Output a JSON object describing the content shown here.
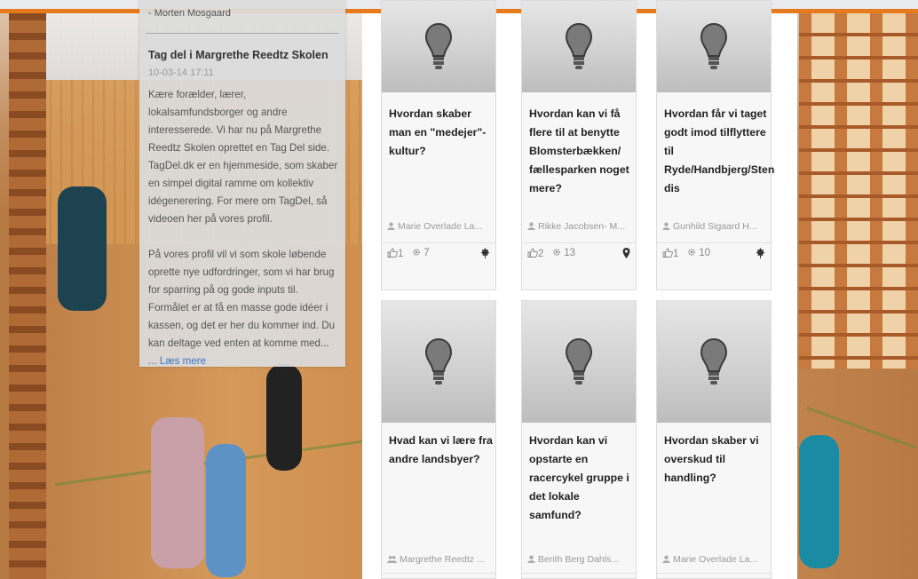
{
  "colors": {
    "accent": "#e67b1e",
    "link": "#3a79c7"
  },
  "info": {
    "author": "- Morten Mosgaard",
    "title": "Tag del i Margrethe Reedtz Skolen",
    "date": "10-03-14 17:11",
    "paragraph1": "Kære forælder, lærer, lokalsamfundsborger og andre interesserede. Vi har nu på Margrethe Reedtz Skolen oprettet en Tag Del side. TagDel.dk er en hjemmeside, som skaber en simpel digital ramme om kollektiv idégenerering. For mere om TagDel, så videoen her på vores profil.",
    "paragraph2": "På vores profil vil vi som skole løbende oprette nye udfordringer, som vi har brug for sparring på og gode inputs til. Formålet er at få en masse gode idéer i kassen, og det er her du kommer ind. Du kan deltage ved enten at komme med...",
    "more": "... Læs mere"
  },
  "cards": [
    {
      "title": "Hvordan skaber man en \"medejer\"-kultur?",
      "author": "Marie Overlade La...",
      "likes": "1",
      "comments": "7",
      "marker": "tree-icon"
    },
    {
      "title": "Hvordan kan vi få flere til at benytte Blomsterbækken/ fællesparken noget mere?",
      "author": "Rikke Jacobsen- M...",
      "likes": "2",
      "comments": "13",
      "marker": "pin-icon"
    },
    {
      "title": "Hvordan får vi taget godt imod tilflyttere til Ryde/Handbjerg/Sten dis",
      "author": "Gunhild Sigaard H...",
      "likes": "1",
      "comments": "10",
      "marker": "tree-icon"
    },
    {
      "title": "Hvad kan vi lære fra andre landsbyer?",
      "author": "Margrethe Reedtz ...",
      "author_icon": "group-icon"
    },
    {
      "title": "Hvordan kan vi opstarte en racercykel gruppe i det lokale samfund?",
      "author": "Berith Berg Dahls..."
    },
    {
      "title": "Hvordan skaber vi overskud til handling?",
      "author": "Marie Overlade La..."
    }
  ]
}
